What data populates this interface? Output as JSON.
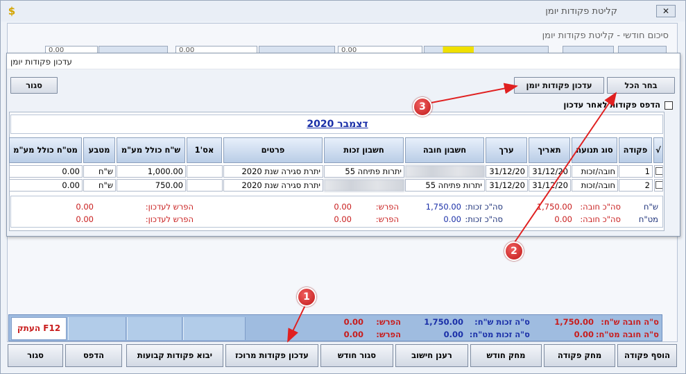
{
  "window": {
    "title": "קליטת פקודות יומן",
    "close": "✕"
  },
  "inner": {
    "title": "סיכום חודשי - קליטת פקודות יומן"
  },
  "strip": {
    "v1": "0.00",
    "v2": "0.00",
    "v3": "0.00"
  },
  "dialog": {
    "title": "עדכון פקודות יומן",
    "close_button": "סגור",
    "update_button": "עדכון פקודות יומן",
    "select_all_button": "בחר הכל",
    "print_after_update": "הדפס פקודות לאחר עדכון",
    "month": "דצמבר 2020",
    "columns": [
      "√",
      "פקודה",
      "סוג תנועה",
      "תאריך",
      "ערך",
      "חשבון חובה",
      "חשבון זכות",
      "פרטים",
      "אס'1",
      "ש\"ח כולל מע\"מ",
      "מטבע",
      "מט\"ח כולל מע\"מ"
    ],
    "rows": [
      {
        "num": "1",
        "type": "חובה/זכות",
        "date": "31/12/20",
        "value": "31/12/20",
        "debit": "",
        "credit": "יתרות פתיחה  55",
        "details": "יתרת סגירה שנת 2020",
        "as1": "",
        "ils": "1,000.00",
        "currency": "ש\"ח",
        "fx": "0.00"
      },
      {
        "num": "2",
        "type": "חובה/זכות",
        "date": "31/12/20",
        "value": "31/12/20",
        "debit": "יתרות פתיחה  55",
        "credit": "",
        "details": "יתרת סגירה שנת 2020",
        "as1": "",
        "ils": "750.00",
        "currency": "ש\"ח",
        "fx": "0.00"
      }
    ],
    "summary": {
      "ils_label": "ש\"ח",
      "fx_label": "מט\"ח",
      "debit_label": "סה\"כ חובה:",
      "credit_label": "סה\"כ זכות:",
      "diff_label": "הפרש:",
      "diff_update_label": "הפרש לעדכון:",
      "ils_debit": "1,750.00",
      "ils_credit": "1,750.00",
      "ils_diff": "0.00",
      "ils_diff_update": "0.00",
      "fx_debit": "0.00",
      "fx_credit": "0.00",
      "fx_diff": "0.00",
      "fx_diff_update": "0.00"
    }
  },
  "totals": {
    "debit_ils_label": "ס\"ה חובה ש\"ח:",
    "debit_ils": "1,750.00",
    "credit_ils_label": "ס\"ה זכות ש\"ח:",
    "credit_ils": "1,750.00",
    "diff_label": "הפרש:",
    "diff_ils": "0.00",
    "debit_fx_label": "ס\"ה חובה מט\"ח:",
    "debit_fx": "0.00",
    "credit_fx_label": "ס\"ה זכות מט\"ח:",
    "credit_fx": "0.00",
    "diff_fx": "0.00",
    "copy_button": "העתק F12"
  },
  "buttons": {
    "add": "הוסף פקודה",
    "delete": "מחק פקודה",
    "delete_month": "מחק חודש",
    "refresh": "רענן חישוב",
    "close_month": "סגור חודש",
    "update_central": "עדכון פקודות מרוכז",
    "import_fixed": "יבוא פקודות קבועות",
    "print": "הדפס",
    "close": "סגור"
  },
  "markers": {
    "m1": "1",
    "m2": "2",
    "m3": "3"
  },
  "colors": {
    "marker": "#c81c1c",
    "accent_blue": "#1a2fa8",
    "totals_bar": "#9fbce0"
  }
}
